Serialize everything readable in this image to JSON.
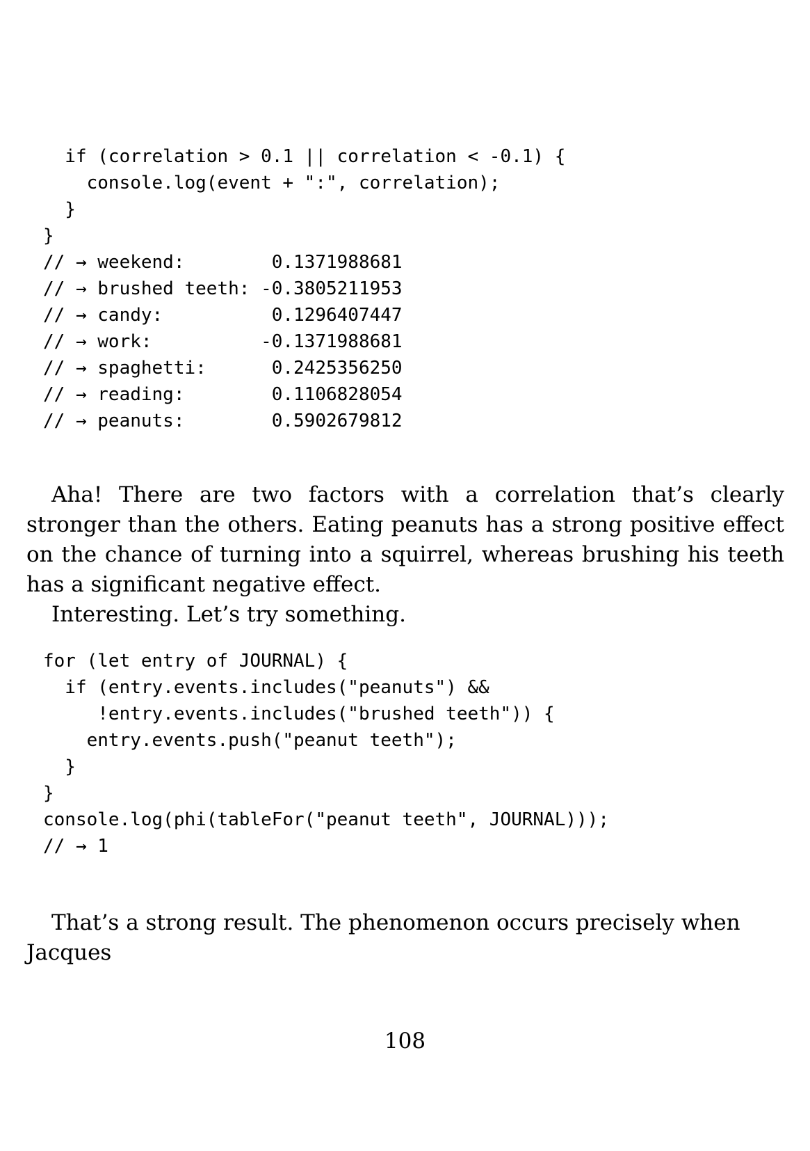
{
  "code_block_1": {
    "lines": [
      "  if (correlation > 0.1 || correlation < -0.1) {",
      "    console.log(event + \":\", correlation);",
      "  }",
      "}",
      "// → weekend:        0.1371988681",
      "// → brushed teeth: -0.3805211953",
      "// → candy:          0.1296407447",
      "// → work:          -0.1371988681",
      "// → spaghetti:      0.2425356250",
      "// → reading:        0.1106828054",
      "// → peanuts:        0.5902679812"
    ]
  },
  "paragraph_1": "Aha! There are two factors with a correlation that’s clearly stronger than the others. Eating peanuts has a strong positive effect on the chance of turning into a squirrel, whereas brushing his teeth has a significant negative effect.",
  "paragraph_2": "Interesting. Let’s try something.",
  "code_block_2": {
    "lines": [
      "for (let entry of JOURNAL) {",
      "  if (entry.events.includes(\"peanuts\") &&",
      "     !entry.events.includes(\"brushed teeth\")) {",
      "    entry.events.push(\"peanut teeth\");",
      "  }",
      "}",
      "console.log(phi(tableFor(\"peanut teeth\", JOURNAL)));",
      "// → 1"
    ]
  },
  "paragraph_3": "That’s a strong result. The phenomenon occurs precisely when Jacques",
  "page_number": "108"
}
